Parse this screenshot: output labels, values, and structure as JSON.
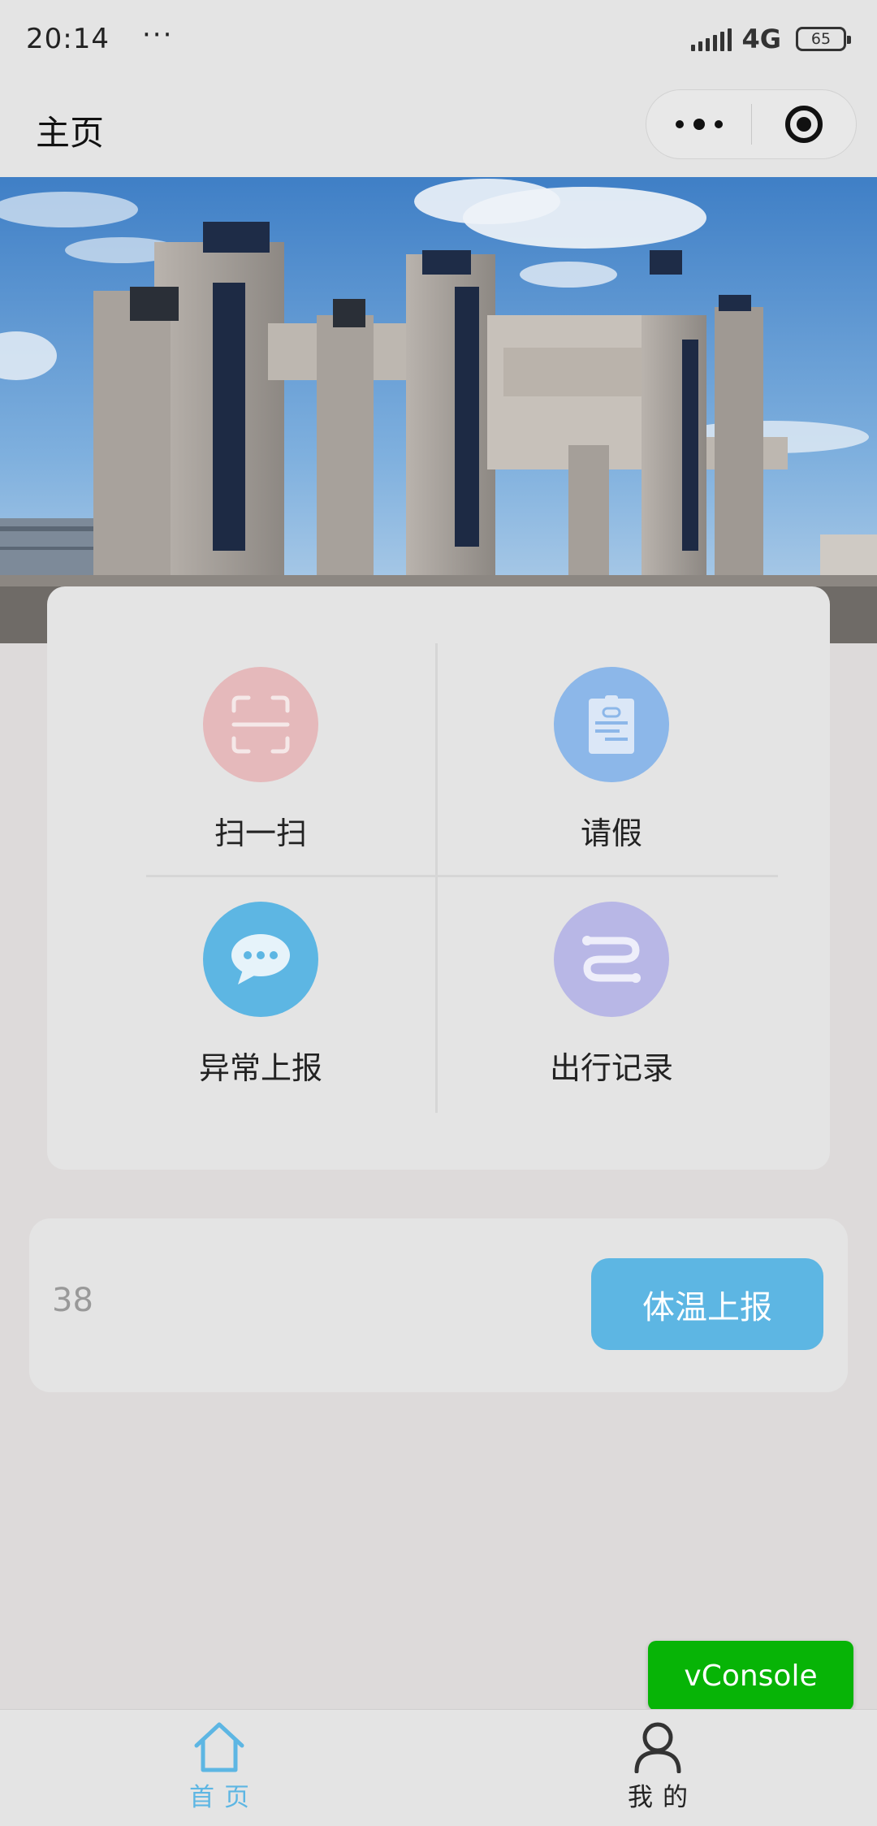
{
  "status_bar": {
    "time": "20:14",
    "more_dots": "···",
    "network": "4G",
    "battery": "65"
  },
  "nav": {
    "title": "主页",
    "capsule_more_icon": "more-dots-icon",
    "capsule_close_icon": "target-icon"
  },
  "banner": {
    "image": "campus-gate-photo"
  },
  "menu": {
    "items": [
      {
        "label": "扫一扫",
        "icon": "scan-icon",
        "color": "#e5b9bb"
      },
      {
        "label": "请假",
        "icon": "leave-note-icon",
        "color": "#8cb7e9"
      },
      {
        "label": "异常上报",
        "icon": "chat-bubble-icon",
        "color": "#5db6e3"
      },
      {
        "label": "出行记录",
        "icon": "route-icon",
        "color": "#b8b7e6"
      }
    ]
  },
  "temperature": {
    "value": "38",
    "button_label": "体温上报"
  },
  "vconsole": {
    "label": "vConsole"
  },
  "tabbar": {
    "items": [
      {
        "label": "首页",
        "icon": "home-icon",
        "active": true
      },
      {
        "label": "我的",
        "icon": "user-icon",
        "active": false
      }
    ],
    "active_color": "#5db6e3"
  }
}
